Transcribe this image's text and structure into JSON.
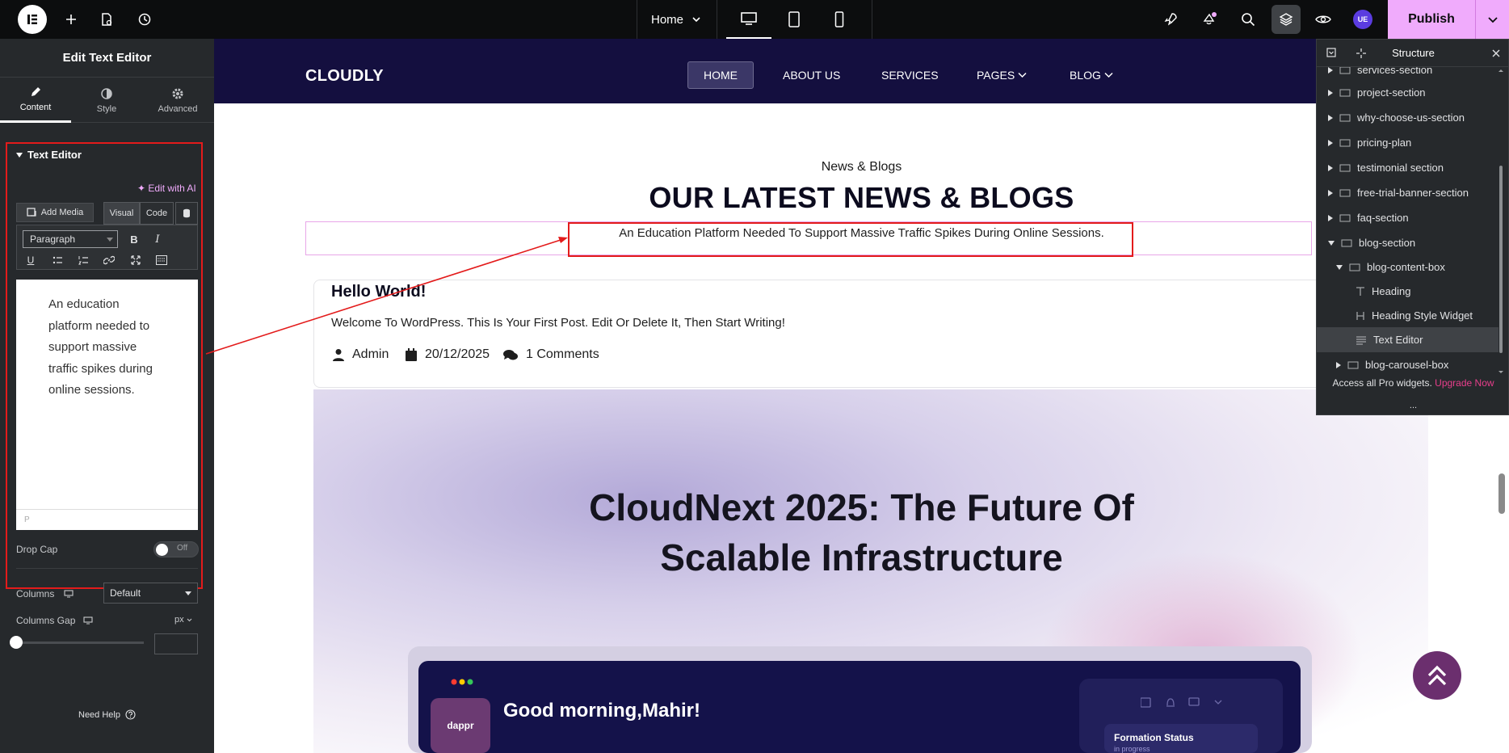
{
  "topbar": {
    "page_name": "Home",
    "publish_label": "Publish",
    "user_badge": "UE"
  },
  "panel": {
    "title": "Edit Text Editor",
    "tabs": [
      {
        "label": "Content",
        "icon": "pencil-icon"
      },
      {
        "label": "Style",
        "icon": "contrast-icon"
      },
      {
        "label": "Advanced",
        "icon": "gear-icon"
      }
    ],
    "section_title": "Text Editor",
    "edit_ai_label": "Edit with AI",
    "add_media_label": "Add Media",
    "visual_tab": "Visual",
    "code_tab": "Code",
    "paragraph_select": "Paragraph",
    "editor_text": "An education platform needed to support massive traffic spikes during online sessions.",
    "editor_path": "P",
    "drop_cap_label": "Drop Cap",
    "drop_cap_state": "Off",
    "columns_label": "Columns",
    "columns_value": "Default",
    "columns_gap_label": "Columns Gap",
    "columns_gap_unit": "px",
    "need_help": "Need Help"
  },
  "site": {
    "brand": "CLOUDLY",
    "nav": [
      "HOME",
      "ABOUT US",
      "SERVICES",
      "PAGES",
      "BLOG"
    ],
    "kicker": "News & Blogs",
    "heading": "OUR LATEST NEWS & BLOGS",
    "subheading": "An Education Platform Needed To Support Massive Traffic Spikes During Online Sessions.",
    "post": {
      "title": "Hello World!",
      "excerpt": "Welcome To WordPress. This Is Your First Post. Edit Or Delete It, Then Start Writing!",
      "author": "Admin",
      "date": "20/12/2025",
      "comments": "1 Comments"
    },
    "feature_title_line1": "CloudNext 2025: The Future Of",
    "feature_title_line2": "Scalable Infrastructure",
    "mock": {
      "app_label": "dappr",
      "greeting": "Good morning,Mahir!",
      "status_title": "Formation Status",
      "status_sub": "in progress"
    }
  },
  "structure": {
    "title": "Structure",
    "items": [
      {
        "label": "services-section",
        "level": 0,
        "type": "container"
      },
      {
        "label": "project-section",
        "level": 0,
        "type": "container"
      },
      {
        "label": "why-choose-us-section",
        "level": 0,
        "type": "container"
      },
      {
        "label": "pricing-plan",
        "level": 0,
        "type": "container"
      },
      {
        "label": "testimonial section",
        "level": 0,
        "type": "container"
      },
      {
        "label": "free-trial-banner-section",
        "level": 0,
        "type": "container"
      },
      {
        "label": "faq-section",
        "level": 0,
        "type": "container"
      },
      {
        "label": "blog-section",
        "level": 0,
        "type": "container",
        "expanded": true
      },
      {
        "label": "blog-content-box",
        "level": 1,
        "type": "container",
        "expanded": true
      },
      {
        "label": "Heading",
        "level": 2,
        "type": "heading"
      },
      {
        "label": "Heading Style Widget",
        "level": 2,
        "type": "widget"
      },
      {
        "label": "Text Editor",
        "level": 2,
        "type": "text",
        "selected": true
      },
      {
        "label": "blog-carousel-box",
        "level": 1,
        "type": "container"
      }
    ],
    "upgrade_text": "Access all Pro widgets.",
    "upgrade_link": "Upgrade Now",
    "more": "..."
  },
  "colors": {
    "accent": "#f0abfc",
    "annotation": "#e31b1b",
    "site_nav": "#140f3f",
    "panel_bg": "#26292c"
  }
}
